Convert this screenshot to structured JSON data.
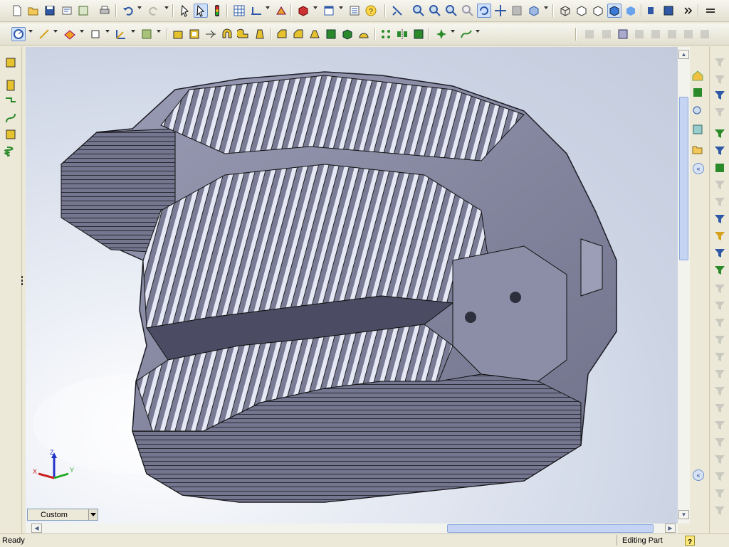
{
  "toolbar1": {
    "icons": [
      "new-icon",
      "open-icon",
      "save-icon",
      "print-preview-icon",
      "options-icon",
      "print-icon",
      "undo-icon",
      "redo-icon",
      "select-icon",
      "smart-select-icon",
      "traffic-light-icon",
      "grid-icon",
      "sketch-dims-icon",
      "rebuild-icon",
      "3d-part-icon",
      "view-orient-icon",
      "properties-icon",
      "help-icon",
      "zoom-fit-icon",
      "zoom-area-icon",
      "zoom-in-icon",
      "zoom-out-icon",
      "zoom-prev-icon",
      "rotate-view-icon",
      "pan-icon",
      "3d-drawing-icon",
      "section-view-icon",
      "wireframe-icon",
      "hidden-lines-visible-icon",
      "hidden-lines-removed-icon",
      "shaded-edges-icon",
      "shaded-icon",
      "perspective-icon",
      "section-icon",
      "more-icon",
      "addins-icon"
    ]
  },
  "toolbar2": {
    "icons": [
      "sketch-icon",
      "smart-dimension-icon",
      "reference-plane-icon",
      "reference-geometry-icon",
      "coordinate-icon",
      "curves-icon",
      "extrude-boss-icon",
      "extrude-cut-icon",
      "revolve-icon",
      "sweep-icon",
      "loft-icon",
      "fillet-icon",
      "chamfer-icon",
      "shell-icon",
      "rib-icon",
      "draft-icon",
      "wrap-icon",
      "dome-icon",
      "pattern-icon",
      "mirror-icon",
      "features-tree-icon",
      "reference-point-icon",
      "spline-icon"
    ]
  },
  "viewport": {
    "triad_x": "X",
    "triad_y": "Y",
    "triad_z": "Z"
  },
  "view_combo": {
    "value": "Custom"
  },
  "status": {
    "left": "Ready",
    "mode": "Editing Part",
    "help": "?"
  },
  "colors": {
    "accent": "#316ac5",
    "model": "#7a7b95",
    "background": "#cdd5e5"
  }
}
